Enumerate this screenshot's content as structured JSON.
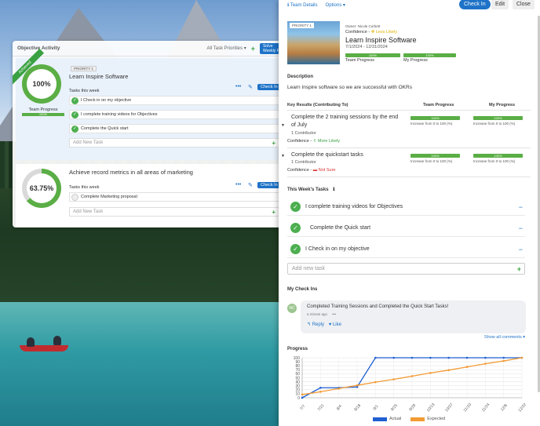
{
  "activity": {
    "title": "Objective Activity",
    "filter": "All Task Priorities ▾",
    "solve_button": "Solve\nWeekly P"
  },
  "objectives": [
    {
      "achieved_ribbon": "Achieved",
      "progress": "100%",
      "progress_value": 100,
      "team_progress_label": "Team Progress",
      "team_progress_bar": "100%",
      "priority": "PRIORITY 1",
      "title": "Learn Inspire Software",
      "tasks_label": "Tasks this week",
      "checkin": "Check In",
      "tasks": [
        {
          "text": "I Check in on my objective",
          "done": true
        },
        {
          "text": "I complete training videos for Objectives",
          "done": true
        },
        {
          "text": "Complete the Quick start",
          "done": true
        }
      ],
      "add_placeholder": "Add New Task"
    },
    {
      "progress": "63.75%",
      "progress_value": 63.75,
      "title": "Achieve record metrics in all areas of marketing",
      "tasks_label": "Tasks this week",
      "checkin": "Check In",
      "tasks": [
        {
          "text": "Complete Marketing proposal",
          "done": false
        }
      ],
      "add_placeholder": "Add New Task"
    }
  ],
  "drawer": {
    "team_details": "ℹ Team Details",
    "options": "Options ▾",
    "checkin": "Check In",
    "edit": "Edit",
    "close": "Close",
    "priority": "PRIORITY 1",
    "owner": "Owner: Nicole Corbett",
    "confidence_label": "Confidence -",
    "confidence_value": "Less Likely",
    "title": "Learn Inspire Software",
    "dates": "7/1/2024 - 12/31/2024",
    "team_progress_bar": "100%",
    "team_progress_label": "Team Progress",
    "my_progress_bar": "100%",
    "my_progress_label": "My Progress",
    "description_label": "Description",
    "description": "Learn Inspire software so we are successful with OKRs",
    "kr_header": "Key Results (Contributing To)",
    "kr_team_header": "Team Progress",
    "kr_my_header": "My Progress",
    "key_results": [
      {
        "title": "Complete the 2 training sessions by the end of July",
        "contributors": "1 Contributor",
        "confidence_label": "Confidence -",
        "confidence_value": "More Likely",
        "team_bar": "100%",
        "team_inc": "Increase from 0 to 100 (%)",
        "my_bar": "100%",
        "my_inc": "Increase from 0 to 100 (%)"
      },
      {
        "title": "Complete the quickstart tasks",
        "contributors": "1 Contributor",
        "confidence_label": "Confidence -",
        "confidence_value": "Not Sure",
        "team_bar": "100%",
        "team_inc": "Increase from 0 to 100 (%)",
        "my_bar": "100%",
        "my_inc": "Increase from 0 to 100 (%)"
      }
    ],
    "weekly_label": "This Week's Tasks",
    "weekly_tasks": [
      "I complete training videos for Objectives",
      "Complete the Quick start",
      "I Check in on my objective"
    ],
    "add_task_placeholder": "Add new task",
    "checkins_label": "My Check Ins",
    "avatar_initials": "NC",
    "comment_text": "Completed Training Sessions and Completed the Quick Start Tasks!",
    "comment_time": "a minute ago",
    "comment_more": "•••",
    "reply": "↰ Reply",
    "like": "♥ Like",
    "show_all": "Show all comments ▾",
    "progress_label": "Progress"
  },
  "chart_data": {
    "type": "line",
    "title": "Progress",
    "x": [
      "7/7",
      "7/21",
      "8/4",
      "8/18",
      "9/1",
      "9/15",
      "9/29",
      "10/13",
      "10/27",
      "11/10",
      "11/24",
      "12/8",
      "12/22"
    ],
    "ylim": [
      0,
      100
    ],
    "yticks": [
      0,
      10,
      20,
      30,
      40,
      50,
      60,
      70,
      80,
      90,
      100
    ],
    "series": [
      {
        "name": "Actual",
        "color": "#1f5fd1",
        "values": [
          0,
          25,
          25,
          27,
          100,
          100,
          100,
          100,
          100,
          100,
          100,
          100,
          100
        ]
      },
      {
        "name": "Expected",
        "color": "#f39b34",
        "values": [
          8,
          15,
          23,
          31,
          39,
          46,
          54,
          62,
          69,
          77,
          85,
          92,
          100
        ]
      }
    ],
    "legend_position": "bottom",
    "grid": true
  },
  "colors": {
    "accent": "#1e73c8",
    "success": "#4caf50",
    "progress": "#5aae45",
    "warning": "#e2b100",
    "danger": "#d33333"
  }
}
